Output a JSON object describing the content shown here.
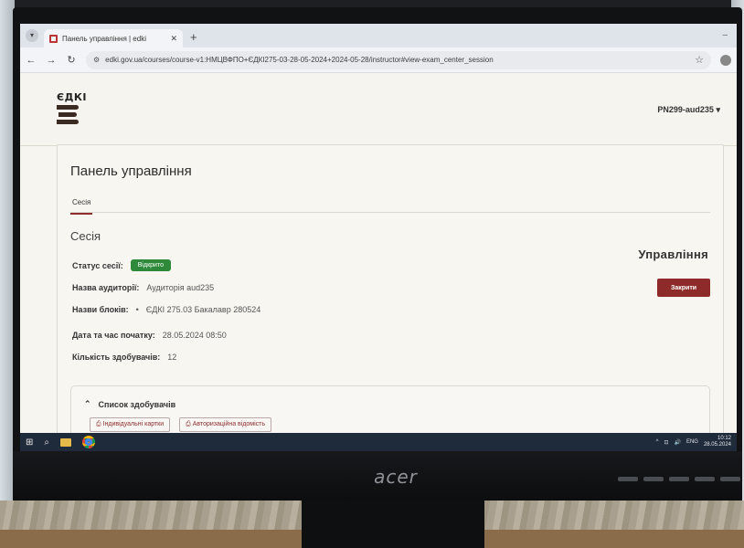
{
  "browser": {
    "tab_title": "Панель управління | edki",
    "url": "edki.gov.ua/courses/course-v1:НМЦВФПО+ЄДКІ275-03-28-05-2024+2024-05-28/instructor#view-exam_center_session"
  },
  "site": {
    "logo_text": "ЄДКІ",
    "user": "PN299-aud235"
  },
  "panel": {
    "title": "Панель управління",
    "tab_session": "Сесія",
    "section_title": "Сесія",
    "status_label": "Статус сесії:",
    "status_value": "Відкрито",
    "room_label": "Назва аудиторії:",
    "room_value": "Аудиторія aud235",
    "blocks_label": "Назви блоків:",
    "blocks_value": "ЄДКІ 275.03 Бакалавр 280524",
    "start_label": "Дата та час початку:",
    "start_value": "28.05.2024 08:50",
    "count_label": "Кількість здобувачів:",
    "count_value": "12",
    "manage_title": "Управління",
    "close_button": "Закрити"
  },
  "students": {
    "title": "Список здобувачів",
    "btn_cards": "Індивідуальні картки",
    "btn_auth": "Авторизаційна відомість"
  },
  "taskbar": {
    "lang": "ENG",
    "time": "10:12",
    "date": "28.05.2024"
  },
  "monitor": {
    "brand": "acer"
  },
  "colors": {
    "accent": "#8e2a2a",
    "status_green": "#2e8a3a"
  }
}
